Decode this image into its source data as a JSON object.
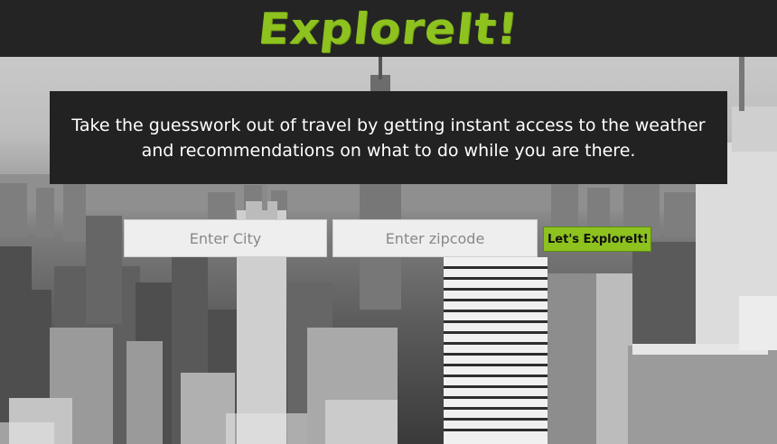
{
  "header": {
    "logo_text": "ExploreIt!",
    "brand_color": "#8dc21f"
  },
  "banner": {
    "text": "Take the guesswork out of travel by getting instant access to the weather and recommendations on what to do while you are there."
  },
  "form": {
    "city_placeholder": "Enter City",
    "zip_placeholder": "Enter zipcode",
    "submit_label": "Let's ExploreIt!"
  },
  "hero": {
    "image": "black-and-white city skyline"
  }
}
